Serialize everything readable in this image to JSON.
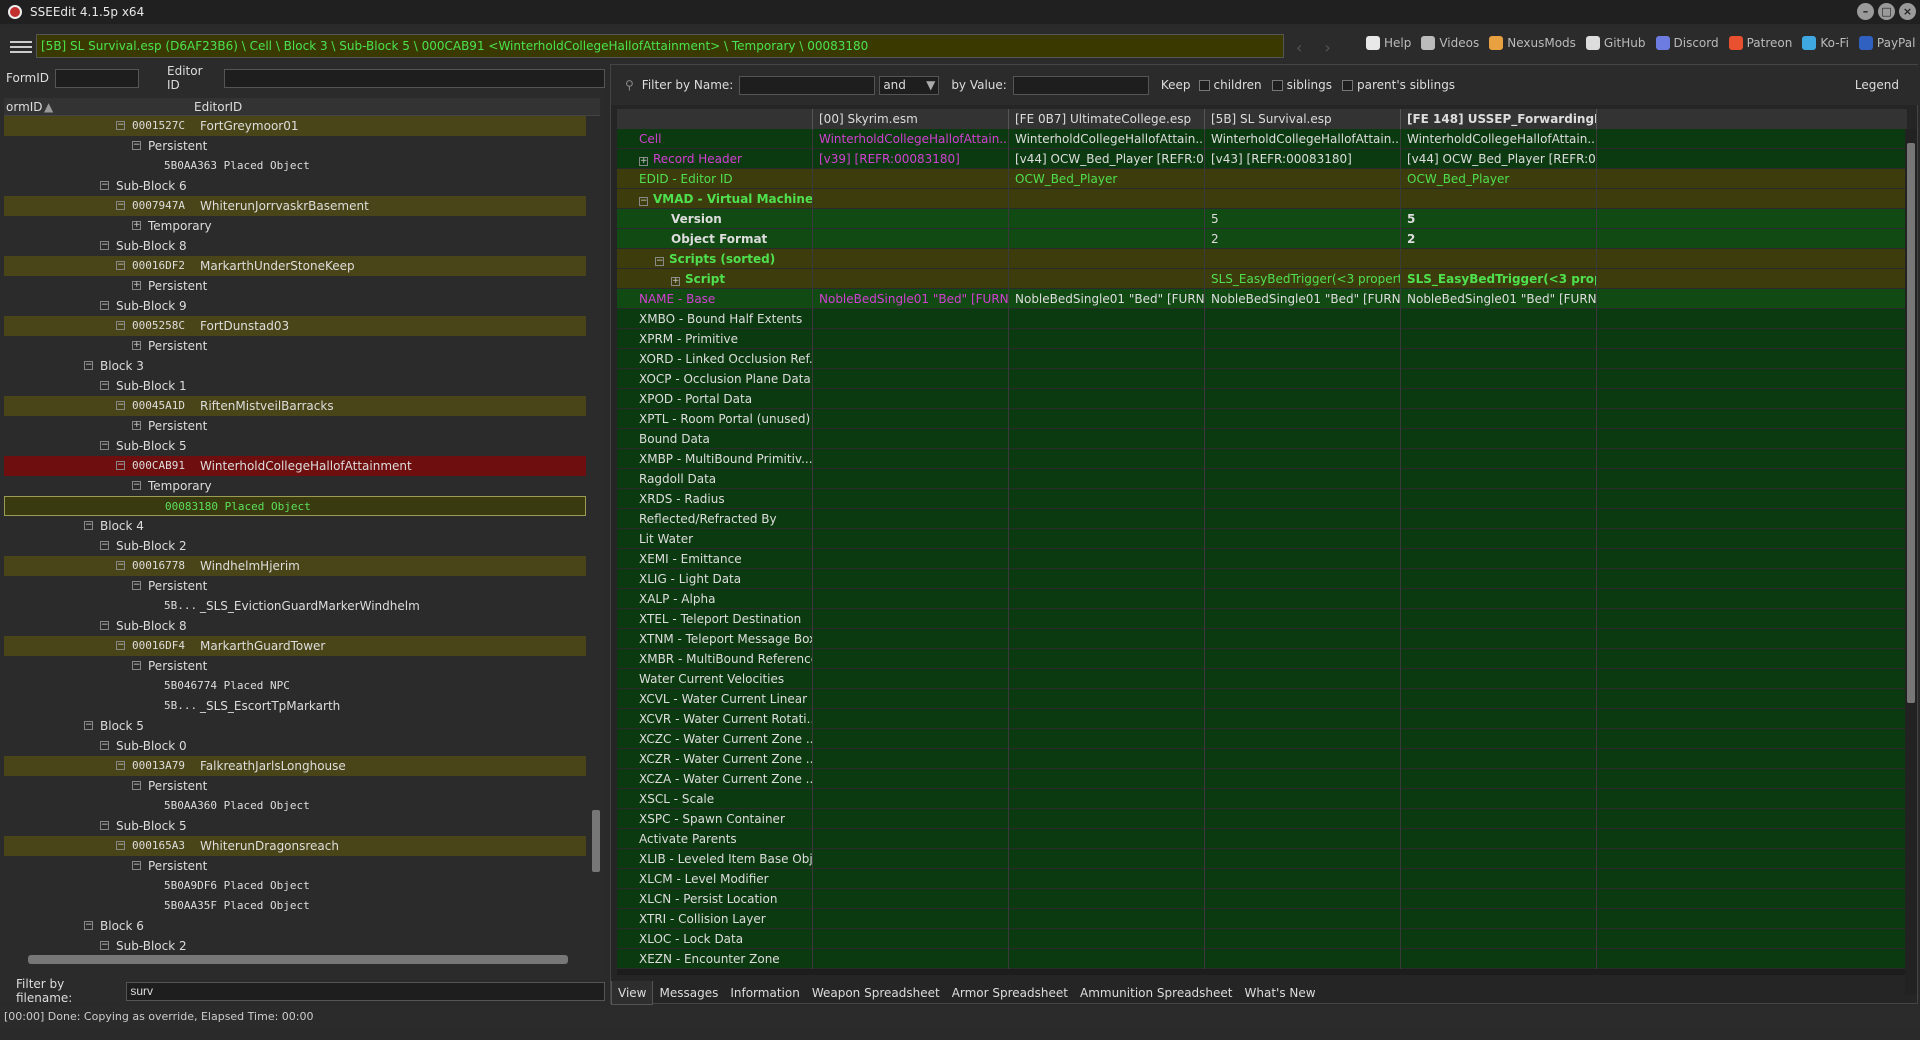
{
  "window": {
    "title": "SSEEdit 4.1.5p x64"
  },
  "toolbar": {
    "path": "[5B] SL Survival.esp (D6AF23B6) \\ Cell \\ Block 3 \\ Sub-Block 5 \\ 000CAB91 <WinterholdCollegeHallofAttainment> \\ Temporary \\ 00083180",
    "links": [
      {
        "label": "Help",
        "icon": "book-icon",
        "color": "#e8e8e8"
      },
      {
        "label": "Videos",
        "icon": "videos-icon",
        "color": "#bbbbbb"
      },
      {
        "label": "NexusMods",
        "icon": "nexusmods-icon",
        "color": "#e8a040"
      },
      {
        "label": "GitHub",
        "icon": "github-icon",
        "color": "#dddddd"
      },
      {
        "label": "Discord",
        "icon": "discord-icon",
        "color": "#6c7ce0"
      },
      {
        "label": "Patreon",
        "icon": "patreon-icon",
        "color": "#e85030"
      },
      {
        "label": "Ko-Fi",
        "icon": "kofi-icon",
        "color": "#40a8e0"
      },
      {
        "label": "PayPal",
        "icon": "paypal-icon",
        "color": "#3060c0"
      }
    ]
  },
  "left": {
    "formid_label": "FormID",
    "editorid_label": "Editor ID",
    "col1": "ormID",
    "col2": "EditorID",
    "tree": [
      {
        "d": 4,
        "t": "0001527C",
        "e": "FortGreymoor01",
        "hl": true,
        "exp": "-"
      },
      {
        "d": 5,
        "t": "Persistent",
        "exp": "-"
      },
      {
        "d": 6,
        "t": "5B0AA363  Placed Object",
        "mono": true
      },
      {
        "d": 3,
        "t": "Sub-Block 6",
        "exp": "-"
      },
      {
        "d": 4,
        "t": "0007947A",
        "e": "WhiterunJorrvaskrBasement",
        "hl": true,
        "exp": "-"
      },
      {
        "d": 5,
        "t": "Temporary",
        "exp": "+"
      },
      {
        "d": 3,
        "t": "Sub-Block 8",
        "exp": "-"
      },
      {
        "d": 4,
        "t": "00016DF2",
        "e": "MarkarthUnderStoneKeep",
        "hl": true,
        "exp": "-"
      },
      {
        "d": 5,
        "t": "Persistent",
        "exp": "+"
      },
      {
        "d": 3,
        "t": "Sub-Block 9",
        "exp": "-"
      },
      {
        "d": 4,
        "t": "0005258C",
        "e": "FortDunstad03",
        "hl": true,
        "exp": "-"
      },
      {
        "d": 5,
        "t": "Persistent",
        "exp": "+"
      },
      {
        "d": 2,
        "t": "Block 3",
        "exp": "-"
      },
      {
        "d": 3,
        "t": "Sub-Block 1",
        "exp": "-"
      },
      {
        "d": 4,
        "t": "00045A1D",
        "e": "RiftenMistveilBarracks",
        "hl": true,
        "exp": "-"
      },
      {
        "d": 5,
        "t": "Persistent",
        "exp": "+"
      },
      {
        "d": 3,
        "t": "Sub-Block 5",
        "exp": "-"
      },
      {
        "d": 4,
        "t": "000CAB91",
        "e": "WinterholdCollegeHallofAttainment",
        "sel": true,
        "exp": "-"
      },
      {
        "d": 5,
        "t": "Temporary",
        "exp": "-"
      },
      {
        "d": 6,
        "t": "00083180  Placed Object",
        "mono": true,
        "cur": true
      },
      {
        "d": 2,
        "t": "Block 4",
        "exp": "-"
      },
      {
        "d": 3,
        "t": "Sub-Block 2",
        "exp": "-"
      },
      {
        "d": 4,
        "t": "00016778",
        "e": "WindhelmHjerim",
        "hl": true,
        "exp": "-"
      },
      {
        "d": 5,
        "t": "Persistent",
        "exp": "-"
      },
      {
        "d": 6,
        "t": "5B...",
        "e": "_SLS_EvictionGuardMarkerWindhelm",
        "mono": true
      },
      {
        "d": 3,
        "t": "Sub-Block 8",
        "exp": "-"
      },
      {
        "d": 4,
        "t": "00016DF4",
        "e": "MarkarthGuardTower",
        "hl": true,
        "exp": "-"
      },
      {
        "d": 5,
        "t": "Persistent",
        "exp": "-"
      },
      {
        "d": 6,
        "t": "5B046774  Placed NPC",
        "mono": true
      },
      {
        "d": 6,
        "t": "5B...",
        "e": "_SLS_EscortTpMarkarth",
        "mono": true
      },
      {
        "d": 2,
        "t": "Block 5",
        "exp": "-"
      },
      {
        "d": 3,
        "t": "Sub-Block 0",
        "exp": "-"
      },
      {
        "d": 4,
        "t": "00013A79",
        "e": "FalkreathJarlsLonghouse",
        "hl": true,
        "exp": "-"
      },
      {
        "d": 5,
        "t": "Persistent",
        "exp": "-"
      },
      {
        "d": 6,
        "t": "5B0AA360  Placed Object",
        "mono": true
      },
      {
        "d": 3,
        "t": "Sub-Block 5",
        "exp": "-"
      },
      {
        "d": 4,
        "t": "000165A3",
        "e": "WhiterunDragonsreach",
        "hl": true,
        "exp": "-"
      },
      {
        "d": 5,
        "t": "Persistent",
        "exp": "-"
      },
      {
        "d": 6,
        "t": "5B0A9DF6  Placed Object",
        "mono": true
      },
      {
        "d": 6,
        "t": "5B0AA35F  Placed Object",
        "mono": true
      },
      {
        "d": 2,
        "t": "Block 6",
        "exp": "-"
      },
      {
        "d": 3,
        "t": "Sub-Block 2",
        "exp": "-"
      }
    ],
    "filter_label": "Filter by filename:",
    "filter_value": "surv"
  },
  "right": {
    "filter_name_label": "Filter by Name:",
    "and_value": "and",
    "by_value_label": "by Value:",
    "keep_label": "Keep",
    "children_label": "children",
    "siblings_label": "siblings",
    "parents_label": "parent's siblings",
    "legend_label": "Legend",
    "headers": [
      "",
      "[00] Skyrim.esm",
      "[FE 0B7] UltimateCollege.esp",
      "[5B] SL Survival.esp",
      "[FE 148] USSEP_ForwardingR_Pa..."
    ],
    "rows": [
      {
        "n": "Cell",
        "c": [
          "WinterholdCollegeHallofAttain...",
          "WinterholdCollegeHallofAttain...",
          "WinterholdCollegeHallofAttain...",
          "WinterholdCollegeHallofAttain..."
        ],
        "bg": "gdark",
        "nc": "pink",
        "cc": [
          "pink",
          "",
          "",
          ""
        ],
        "ind": 1
      },
      {
        "n": "Record Header",
        "c": [
          "[v39] [REFR:00083180]",
          "[v44] OCW_Bed_Player [REFR:000...",
          "[v43] [REFR:00083180]",
          "[v44] OCW_Bed_Player [REFR:000..."
        ],
        "bg": "gdark",
        "nc": "pink",
        "cc": [
          "pink",
          "",
          "",
          ""
        ],
        "ind": 1,
        "exp": "+"
      },
      {
        "n": "EDID - Editor ID",
        "c": [
          "",
          "OCW_Bed_Player",
          "",
          "OCW_Bed_Player"
        ],
        "bg": "ydark",
        "nc": "green",
        "cc": [
          "",
          "green",
          "",
          "green"
        ],
        "ind": 1
      },
      {
        "n": "VMAD - Virtual Machine Ad...",
        "c": [
          "",
          "",
          "",
          ""
        ],
        "bg": "ydark",
        "nc": "green",
        "bold": true,
        "ind": 1,
        "exp": "-"
      },
      {
        "n": "Version",
        "c": [
          "",
          "",
          "5",
          "5"
        ],
        "bg": "gmid",
        "bold": true,
        "ind": 3
      },
      {
        "n": "Object Format",
        "c": [
          "",
          "",
          "2",
          "2"
        ],
        "bg": "gmid",
        "bold": true,
        "ind": 3
      },
      {
        "n": "Scripts (sorted)",
        "c": [
          "",
          "",
          "",
          ""
        ],
        "bg": "ydark",
        "nc": "green",
        "bold": true,
        "ind": 2,
        "exp": "-"
      },
      {
        "n": "Script",
        "c": [
          "",
          "",
          "SLS_EasyBedTrigger(<3 propertie...",
          "SLS_EasyBedTrigger(<3 proper..."
        ],
        "bg": "ydark",
        "nc": "green",
        "bold": true,
        "cc": [
          "",
          "",
          "green",
          "green"
        ],
        "ind": 3,
        "exp": "+"
      },
      {
        "n": "NAME - Base",
        "c": [
          "NobleBedSingle01 \"Bed\" [FURN:...",
          "NobleBedSingle01 \"Bed\" [FURN:...",
          "NobleBedSingle01 \"Bed\" [FURN:...",
          "NobleBedSingle01 \"Bed\" [FURN:..."
        ],
        "bg": "gmid",
        "nc": "pink",
        "cc": [
          "pink",
          "",
          "",
          ""
        ],
        "ind": 1
      },
      {
        "n": "XMBO - Bound Half Extents",
        "c": [
          "",
          "",
          "",
          ""
        ],
        "bg": "gdark",
        "ind": 1
      },
      {
        "n": "XPRM - Primitive",
        "c": [
          "",
          "",
          "",
          ""
        ],
        "bg": "gdark",
        "ind": 1
      },
      {
        "n": "XORD - Linked Occlusion Ref...",
        "c": [
          "",
          "",
          "",
          ""
        ],
        "bg": "gdark",
        "ind": 1
      },
      {
        "n": "XOCP - Occlusion Plane Data",
        "c": [
          "",
          "",
          "",
          ""
        ],
        "bg": "gdark",
        "ind": 1
      },
      {
        "n": "XPOD - Portal Data",
        "c": [
          "",
          "",
          "",
          ""
        ],
        "bg": "gdark",
        "ind": 1
      },
      {
        "n": "XPTL - Room Portal (unused)",
        "c": [
          "",
          "",
          "",
          ""
        ],
        "bg": "gdark",
        "ind": 1
      },
      {
        "n": "Bound Data",
        "c": [
          "",
          "",
          "",
          ""
        ],
        "bg": "gdark",
        "ind": 1
      },
      {
        "n": "XMBP - MultiBound Primitiv...",
        "c": [
          "",
          "",
          "",
          ""
        ],
        "bg": "gdark",
        "ind": 1
      },
      {
        "n": "Ragdoll Data",
        "c": [
          "",
          "",
          "",
          ""
        ],
        "bg": "gdark",
        "ind": 1
      },
      {
        "n": "XRDS - Radius",
        "c": [
          "",
          "",
          "",
          ""
        ],
        "bg": "gdark",
        "ind": 1
      },
      {
        "n": "Reflected/Refracted By",
        "c": [
          "",
          "",
          "",
          ""
        ],
        "bg": "gdark",
        "ind": 1
      },
      {
        "n": "Lit Water",
        "c": [
          "",
          "",
          "",
          ""
        ],
        "bg": "gdark",
        "ind": 1
      },
      {
        "n": "XEMI - Emittance",
        "c": [
          "",
          "",
          "",
          ""
        ],
        "bg": "gdark",
        "ind": 1
      },
      {
        "n": "XLIG - Light Data",
        "c": [
          "",
          "",
          "",
          ""
        ],
        "bg": "gdark",
        "ind": 1
      },
      {
        "n": "XALP - Alpha",
        "c": [
          "",
          "",
          "",
          ""
        ],
        "bg": "gdark",
        "ind": 1
      },
      {
        "n": "XTEL - Teleport Destination",
        "c": [
          "",
          "",
          "",
          ""
        ],
        "bg": "gdark",
        "ind": 1
      },
      {
        "n": "XTNM - Teleport Message Box",
        "c": [
          "",
          "",
          "",
          ""
        ],
        "bg": "gdark",
        "ind": 1
      },
      {
        "n": "XMBR - MultiBound Reference",
        "c": [
          "",
          "",
          "",
          ""
        ],
        "bg": "gdark",
        "ind": 1
      },
      {
        "n": "Water Current Velocities",
        "c": [
          "",
          "",
          "",
          ""
        ],
        "bg": "gdark",
        "ind": 1
      },
      {
        "n": "XCVL - Water Current Linear ...",
        "c": [
          "",
          "",
          "",
          ""
        ],
        "bg": "gdark",
        "ind": 1
      },
      {
        "n": "XCVR - Water Current Rotati...",
        "c": [
          "",
          "",
          "",
          ""
        ],
        "bg": "gdark",
        "ind": 1
      },
      {
        "n": "XCZC - Water Current Zone ...",
        "c": [
          "",
          "",
          "",
          ""
        ],
        "bg": "gdark",
        "ind": 1
      },
      {
        "n": "XCZR - Water Current Zone ...",
        "c": [
          "",
          "",
          "",
          ""
        ],
        "bg": "gdark",
        "ind": 1
      },
      {
        "n": "XCZA - Water Current Zone ...",
        "c": [
          "",
          "",
          "",
          ""
        ],
        "bg": "gdark",
        "ind": 1
      },
      {
        "n": "XSCL - Scale",
        "c": [
          "",
          "",
          "",
          ""
        ],
        "bg": "gdark",
        "ind": 1
      },
      {
        "n": "XSPC - Spawn Container",
        "c": [
          "",
          "",
          "",
          ""
        ],
        "bg": "gdark",
        "ind": 1
      },
      {
        "n": "Activate Parents",
        "c": [
          "",
          "",
          "",
          ""
        ],
        "bg": "gdark",
        "ind": 1
      },
      {
        "n": "XLIB - Leveled Item Base Obj...",
        "c": [
          "",
          "",
          "",
          ""
        ],
        "bg": "gdark",
        "ind": 1
      },
      {
        "n": "XLCM - Level Modifier",
        "c": [
          "",
          "",
          "",
          ""
        ],
        "bg": "gdark",
        "ind": 1
      },
      {
        "n": "XLCN - Persist Location",
        "c": [
          "",
          "",
          "",
          ""
        ],
        "bg": "gdark",
        "ind": 1
      },
      {
        "n": "XTRI - Collision Layer",
        "c": [
          "",
          "",
          "",
          ""
        ],
        "bg": "gdark",
        "ind": 1
      },
      {
        "n": "XLOC - Lock Data",
        "c": [
          "",
          "",
          "",
          ""
        ],
        "bg": "gdark",
        "ind": 1
      },
      {
        "n": "XEZN - Encounter Zone",
        "c": [
          "",
          "",
          "",
          ""
        ],
        "bg": "gdark",
        "ind": 1
      }
    ],
    "tabs": [
      "View",
      "Messages",
      "Information",
      "Weapon Spreadsheet",
      "Armor Spreadsheet",
      "Ammunition Spreadsheet",
      "What's New"
    ]
  },
  "status": {
    "text": "[00:00] Done: Copying as override, Elapsed Time: 00:00"
  }
}
